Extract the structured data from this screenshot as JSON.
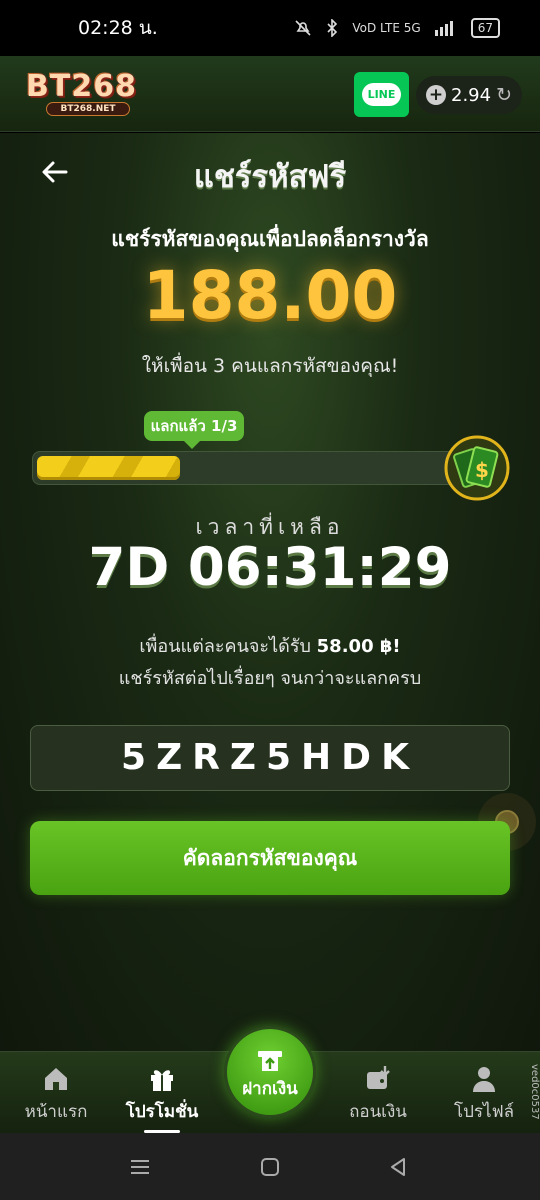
{
  "status_bar": {
    "time": "02:28 น.",
    "indicators": "VoD LTE 5G",
    "battery": "67"
  },
  "header": {
    "logo": "BT268",
    "logo_sub": "BT268.NET",
    "line_label": "LINE",
    "balance": "2.94"
  },
  "page": {
    "title": "แชร์รหัสฟรี",
    "subtitle": "แชร์รหัสของคุณเพื่อปลดล็อกรางวัล",
    "amount": "188.00",
    "invite_text": "ให้เพื่อน 3 คนแลกรหัสของคุณ!",
    "progress_label": "แลกแล้ว 1/3",
    "progress_fraction": 0.333,
    "time_label": "เวลาที่เหลือ",
    "countdown": "7D 06:31:29",
    "note_prefix": "เพื่อนแต่ละคนจะได้รับ ",
    "note_amount": "58.00 ฿!",
    "note_line2": "แชร์รหัสต่อไปเรื่อยๆ จนกว่าจะแลกครบ",
    "code": "5ZRZ5HDK",
    "copy_button": "คัดลอกรหัสของคุณ"
  },
  "bottom_nav": {
    "home": "หน้าแรก",
    "promotions": "โปรโมชั่น",
    "deposit": "ฝากเงิน",
    "withdraw": "ถอนเงิน",
    "profile": "โปรไฟล์",
    "active": "promotions"
  },
  "version": "ved0c0537",
  "colors": {
    "accent": "#5fb934",
    "gold": "#ffc43d",
    "bg": "#1a2a14"
  }
}
